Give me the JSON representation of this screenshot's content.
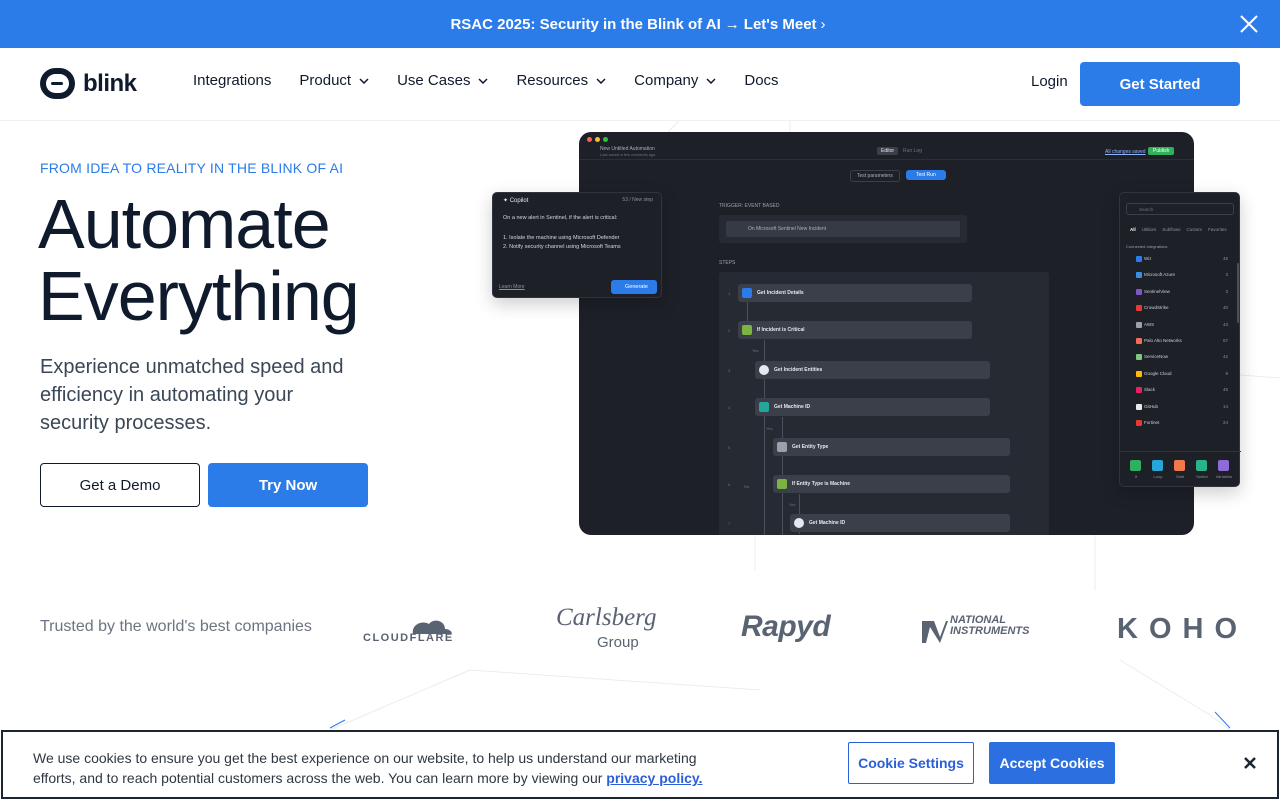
{
  "announcement": {
    "text": "RSAC 2025: Security in the Blink of AI",
    "arrow": "→",
    "cta": "Let's Meet",
    "cta_chevron": "›",
    "close_icon": "close-icon"
  },
  "nav": {
    "logo_text": "blink",
    "links": [
      {
        "label": "Integrations",
        "dropdown": false
      },
      {
        "label": "Product",
        "dropdown": true
      },
      {
        "label": "Use Cases",
        "dropdown": true
      },
      {
        "label": "Resources",
        "dropdown": true
      },
      {
        "label": "Company",
        "dropdown": true
      },
      {
        "label": "Docs",
        "dropdown": false
      }
    ],
    "login": "Login",
    "get_started": "Get Started"
  },
  "hero": {
    "eyebrow": "FROM IDEA TO REALITY IN THE BLINK OF AI",
    "title_line1": "Automate",
    "title_line2": "Everything",
    "subtitle": "Experience unmatched speed and efficiency in automating your security processes.",
    "demo_button": "Get a Demo",
    "try_button": "Try Now"
  },
  "app": {
    "title": "New Untitled Automation",
    "subtitle": "Last saved a few moments ago",
    "tab_editor": "Editor",
    "tab_runlog": "Run Log",
    "saved": "All changes saved",
    "publish": "Publish",
    "test_params": "Test parameters",
    "test_run": "Test Run",
    "trigger_label": "TRIGGER: EVENT BASED",
    "trigger_value": "On Microsoft Sentinel New Incident",
    "steps_label": "STEPS",
    "steps": [
      {
        "num": "1",
        "label": "Get Incident Details",
        "color": "#2b7ce9"
      },
      {
        "num": "2",
        "label": "If Incident is Critical",
        "color": "#7cb342"
      },
      {
        "num": "3",
        "label": "Get Incident Entities",
        "color": "#e6e9ee"
      },
      {
        "num": "4",
        "label": "Get Machine ID",
        "color": "#26a69a"
      },
      {
        "num": "5",
        "label": "Get Entity Type",
        "color": "#9aa1ad"
      },
      {
        "num": "6",
        "label": "If Entity Type is Machine",
        "color": "#7cb342"
      },
      {
        "num": "7",
        "label": "Get Machine ID",
        "color": "#e6e9ee"
      }
    ],
    "yes_label": "Yes",
    "no_label": "No"
  },
  "copilot": {
    "title": "Copilot",
    "step_count": "53 / New step",
    "prompt": "On a new alert in Sentinel, if the alert is critical:",
    "items": [
      "1. Isolate the machine using Microsoft Defender",
      "2. Notify security channel using Microsoft Teams"
    ],
    "learn_more": "Learn More",
    "generate": "Generate"
  },
  "integrations": {
    "search_placeholder": "Search",
    "tabs": [
      "All",
      "Utilities",
      "Subflows",
      "Custom",
      "Favorites"
    ],
    "connected_label": "Connected Integrations",
    "items": [
      {
        "name": "Wiz",
        "count": "46",
        "color": "#2b7ce9"
      },
      {
        "name": "Microsoft Azure",
        "count": "3",
        "color": "#3a8ee6"
      },
      {
        "name": "SentinelView",
        "count": "3",
        "color": "#7e57c2"
      },
      {
        "name": "CrowdStrike",
        "count": "40",
        "color": "#e53935"
      },
      {
        "name": "AWS",
        "count": "43",
        "color": "#9aa1ad"
      },
      {
        "name": "Palo Alto Networks",
        "count": "67",
        "color": "#ef6c57"
      },
      {
        "name": "ServiceNow",
        "count": "42",
        "color": "#81c784"
      },
      {
        "name": "Google Cloud",
        "count": "8",
        "color": "#fbbc05"
      },
      {
        "name": "Slack",
        "count": "46",
        "color": "#e91e63"
      },
      {
        "name": "GitHub",
        "count": "14",
        "color": "#e6e9ee"
      },
      {
        "name": "Fortinet",
        "count": "24",
        "color": "#e53935"
      }
    ],
    "tools": [
      {
        "label": "If",
        "color": "#2fb15c"
      },
      {
        "label": "Loop",
        "color": "#26a6d9"
      },
      {
        "label": "Wait",
        "color": "#f0784a"
      },
      {
        "label": "Switch",
        "color": "#29b38a"
      },
      {
        "label": "Variables",
        "color": "#8e6bd8"
      }
    ]
  },
  "trusted": {
    "label": "Trusted by the world's best companies",
    "logos": [
      "CLOUDFLARE",
      "Carlsberg",
      "Group",
      "Rapyd",
      "NATIONAL",
      "INSTRUMENTS",
      "KOHO"
    ]
  },
  "cookie": {
    "text": "We use cookies to ensure you get the best experience on our website, to help us understand our marketing efforts, and to reach potential customers across the web. You can learn more by viewing our",
    "link": "privacy policy.",
    "settings": "Cookie Settings",
    "accept": "Accept Cookies",
    "close_icon": "close-icon"
  },
  "colors": {
    "brand_blue": "#2b7ce9",
    "navy": "#0f1b2d",
    "app_bg": "#1d2027"
  }
}
